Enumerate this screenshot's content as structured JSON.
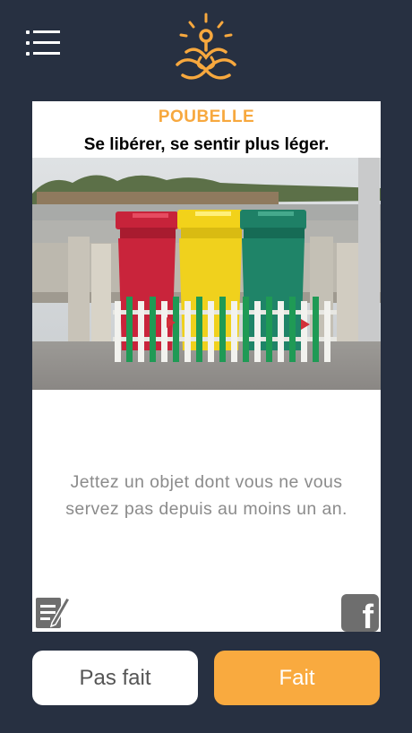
{
  "header": {
    "menu_icon": "hamburger-menu-icon",
    "logo_icon": "meditation-lotus-logo-icon",
    "accent_color": "#f7a83e",
    "background_color": "#273041"
  },
  "card": {
    "title": "POUBELLE",
    "subtitle": "Se libérer, se sentir plus léger.",
    "image": "three-wheelie-bins-red-yellow-green-photo",
    "text": "Jettez un objet dont vous ne vous servez pas depuis au moins un an.",
    "note_icon": "edit-note-icon",
    "share_icon": "facebook-icon"
  },
  "actions": {
    "not_done_label": "Pas fait",
    "done_label": "Fait"
  }
}
